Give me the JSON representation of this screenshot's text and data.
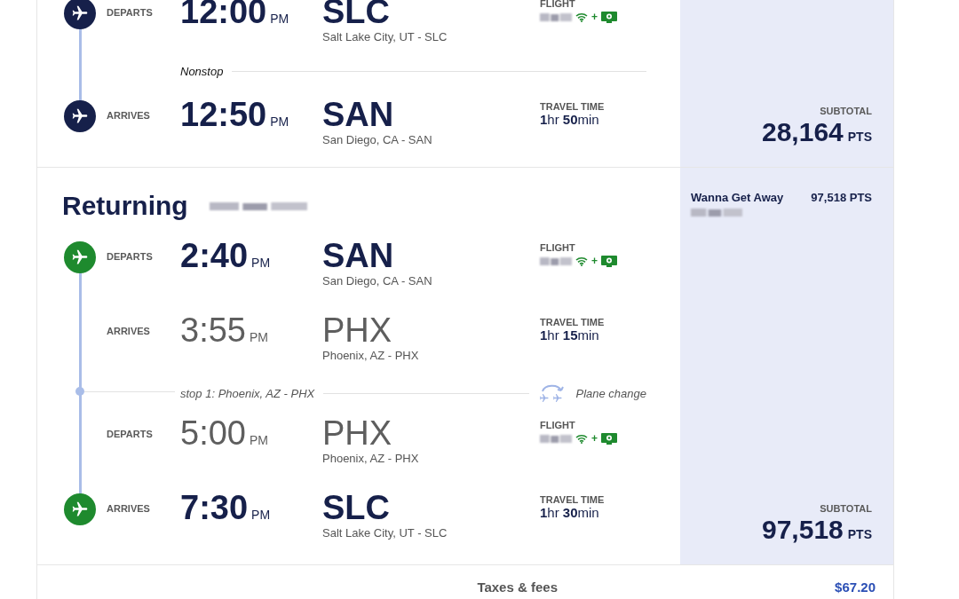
{
  "sections": [
    {
      "kind": "leg",
      "color": "#16204a",
      "rows": [
        {
          "kind": "segment",
          "endpoint": true,
          "label": "DEPARTS",
          "time": "12:00",
          "period": "PM",
          "code": "SLC",
          "city": "Salt Lake City, UT - SLC",
          "info": {
            "kind": "flight",
            "label": "FLIGHT",
            "plus": "+"
          }
        },
        {
          "kind": "connector",
          "stop": false,
          "text": "Nonstop"
        },
        {
          "kind": "segment",
          "endpoint": true,
          "label": "ARRIVES",
          "time": "12:50",
          "period": "PM",
          "code": "SAN",
          "city": "San Diego, CA - SAN",
          "info": {
            "kind": "travel_time",
            "label": "TRAVEL TIME",
            "value": "**1**hr **50**min"
          }
        }
      ],
      "price": {
        "label": "SUBTOTAL",
        "points": "28,164",
        "unit": "PTS"
      }
    },
    {
      "kind": "leg",
      "title": "Returning",
      "color": "#1e8a2e",
      "fare": {
        "name": "Wanna Get Away",
        "points": "97,518 PTS"
      },
      "rows": [
        {
          "kind": "segment",
          "endpoint": true,
          "label": "DEPARTS",
          "time": "2:40",
          "period": "PM",
          "code": "SAN",
          "city": "San Diego, CA - SAN",
          "info": {
            "kind": "flight",
            "label": "FLIGHT",
            "plus": "+"
          }
        },
        {
          "kind": "segment",
          "endpoint": false,
          "label": "ARRIVES",
          "time": "3:55",
          "period": "PM",
          "code": "PHX",
          "city": "Phoenix, AZ - PHX",
          "info": {
            "kind": "travel_time",
            "label": "TRAVEL TIME",
            "value": "**1**hr **15**min"
          }
        },
        {
          "kind": "connector",
          "stop": true,
          "text": "stop 1: Phoenix, AZ - PHX",
          "note": "Plane change"
        },
        {
          "kind": "segment",
          "endpoint": false,
          "label": "DEPARTS",
          "time": "5:00",
          "period": "PM",
          "code": "PHX",
          "city": "Phoenix, AZ - PHX",
          "info": {
            "kind": "flight",
            "label": "FLIGHT",
            "plus": "+"
          }
        },
        {
          "kind": "segment",
          "endpoint": true,
          "label": "ARRIVES",
          "time": "7:30",
          "period": "PM",
          "code": "SLC",
          "city": "Salt Lake City, UT - SLC",
          "info": {
            "kind": "travel_time",
            "label": "TRAVEL TIME",
            "value": "**1**hr **30**min"
          }
        }
      ],
      "price": {
        "label": "SUBTOTAL",
        "points": "97,518",
        "unit": "PTS"
      }
    }
  ],
  "totals": {
    "label": "Taxes & fees",
    "amount": "$67.20"
  }
}
